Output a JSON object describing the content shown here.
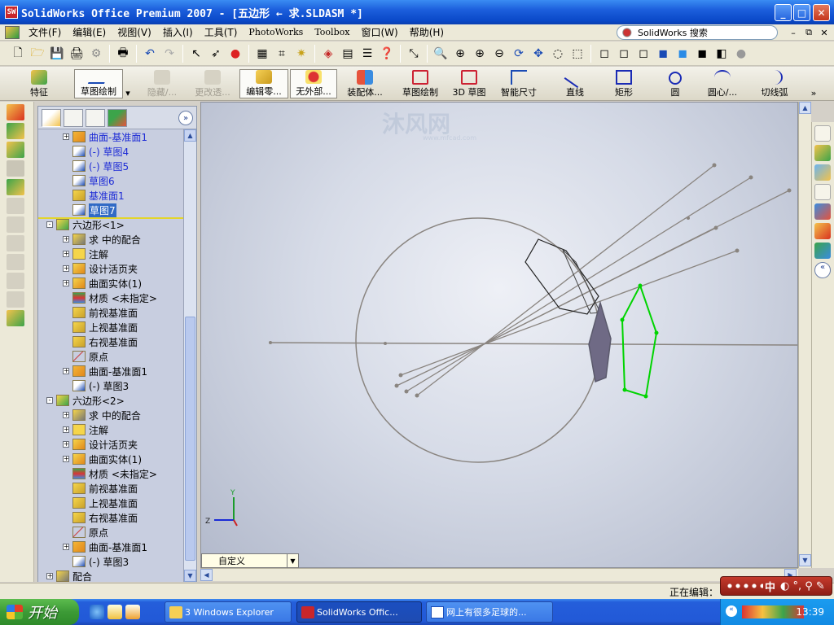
{
  "window": {
    "title": "SolidWorks Office Premium 2007 - [五边形 ← 求.SLDASM *]",
    "app_icon": "SW"
  },
  "menu": {
    "items": [
      "文件(F)",
      "编辑(E)",
      "视图(V)",
      "插入(I)",
      "工具(T)",
      "PhotoWorks",
      "Toolbox",
      "窗口(W)",
      "帮助(H)"
    ],
    "search_label": "SolidWorks 搜索"
  },
  "commandmanager": {
    "features": "特征",
    "sketch": "草图绘制",
    "hide": "隐藏/...",
    "change_transparency": "更改透...",
    "edit_part": "编辑零...",
    "no_external": "无外部...",
    "assembly_body": "装配体...",
    "sketch2": "草图绘制",
    "sketch3d": "3D 草图",
    "smart_dim": "智能尺寸",
    "line": "直线",
    "rectangle": "矩形",
    "circle": "圆",
    "centerpoint_arc": "圆心/...",
    "tangent_arc": "切线弧"
  },
  "tree": {
    "rows": [
      {
        "label": "曲面-基准面1",
        "icon": "surface-plane-icon",
        "indent": 1,
        "expand": "+",
        "color": "blue"
      },
      {
        "label": "(-) 草图4",
        "icon": "sketch-icon",
        "indent": 1,
        "expand": "",
        "color": "blue"
      },
      {
        "label": "(-) 草图5",
        "icon": "sketch-icon",
        "indent": 1,
        "expand": "",
        "color": "blue"
      },
      {
        "label": "草图6",
        "icon": "sketch-icon",
        "indent": 1,
        "expand": "",
        "color": "blue"
      },
      {
        "label": "基准面1",
        "icon": "plane-icon",
        "indent": 1,
        "expand": "",
        "color": "blue"
      },
      {
        "label": "草图7",
        "icon": "sketch-icon",
        "indent": 1,
        "expand": "",
        "color": "selected"
      },
      {
        "label": "六边形<1>",
        "icon": "part-icon",
        "indent": 0,
        "expand": "-",
        "color": "black"
      },
      {
        "label": "求 中的配合",
        "icon": "mates-icon",
        "indent": 1,
        "expand": "+",
        "color": "black"
      },
      {
        "label": "注解",
        "icon": "annotation-icon",
        "indent": 1,
        "expand": "+",
        "color": "black"
      },
      {
        "label": "设计活页夹",
        "icon": "design-binder-icon",
        "indent": 1,
        "expand": "+",
        "color": "black"
      },
      {
        "label": "曲面实体(1)",
        "icon": "surface-body-icon",
        "indent": 1,
        "expand": "+",
        "color": "black"
      },
      {
        "label": "材质 <未指定>",
        "icon": "material-icon",
        "indent": 1,
        "expand": "",
        "color": "black"
      },
      {
        "label": "前视基准面",
        "icon": "plane-icon",
        "indent": 1,
        "expand": "",
        "color": "black"
      },
      {
        "label": "上视基准面",
        "icon": "plane-icon",
        "indent": 1,
        "expand": "",
        "color": "black"
      },
      {
        "label": "右视基准面",
        "icon": "plane-icon",
        "indent": 1,
        "expand": "",
        "color": "black"
      },
      {
        "label": "原点",
        "icon": "origin-icon",
        "indent": 1,
        "expand": "",
        "color": "black"
      },
      {
        "label": "曲面-基准面1",
        "icon": "surface-plane-icon",
        "indent": 1,
        "expand": "+",
        "color": "black"
      },
      {
        "label": "(-) 草图3",
        "icon": "sketch-icon",
        "indent": 1,
        "expand": "",
        "color": "black"
      },
      {
        "label": "六边形<2>",
        "icon": "part-icon",
        "indent": 0,
        "expand": "-",
        "color": "black"
      },
      {
        "label": "求 中的配合",
        "icon": "mates-icon",
        "indent": 1,
        "expand": "+",
        "color": "black"
      },
      {
        "label": "注解",
        "icon": "annotation-icon",
        "indent": 1,
        "expand": "+",
        "color": "black"
      },
      {
        "label": "设计活页夹",
        "icon": "design-binder-icon",
        "indent": 1,
        "expand": "+",
        "color": "black"
      },
      {
        "label": "曲面实体(1)",
        "icon": "surface-body-icon",
        "indent": 1,
        "expand": "+",
        "color": "black"
      },
      {
        "label": "材质 <未指定>",
        "icon": "material-icon",
        "indent": 1,
        "expand": "",
        "color": "black"
      },
      {
        "label": "前视基准面",
        "icon": "plane-icon",
        "indent": 1,
        "expand": "",
        "color": "black"
      },
      {
        "label": "上视基准面",
        "icon": "plane-icon",
        "indent": 1,
        "expand": "",
        "color": "black"
      },
      {
        "label": "右视基准面",
        "icon": "plane-icon",
        "indent": 1,
        "expand": "",
        "color": "black"
      },
      {
        "label": "原点",
        "icon": "origin-icon",
        "indent": 1,
        "expand": "",
        "color": "black"
      },
      {
        "label": "曲面-基准面1",
        "icon": "surface-plane-icon",
        "indent": 1,
        "expand": "+",
        "color": "black"
      },
      {
        "label": "(-) 草图3",
        "icon": "sketch-icon",
        "indent": 1,
        "expand": "",
        "color": "black"
      },
      {
        "label": "配合",
        "icon": "mates-icon",
        "indent": 0,
        "expand": "+",
        "color": "black"
      }
    ]
  },
  "viewport": {
    "view_tab": "自定义",
    "watermark": "沐风网",
    "watermark_url": "www.mfcad.com",
    "triad": {
      "x": "",
      "y": "Y",
      "z": "Z"
    }
  },
  "statusbar": {
    "status": "正在编辑："
  },
  "ime": {
    "label": "中"
  },
  "taskbar": {
    "start": "开始",
    "tasks": [
      "3 Windows Explorer",
      "SolidWorks Offic...",
      "网上有很多足球的..."
    ],
    "clock": "13:39"
  },
  "colors": {
    "accent": "#316ac5",
    "tree_blue_text": "#1d2bd6",
    "sketch_green": "#00cc00",
    "titlebar": "#0a48c8"
  }
}
